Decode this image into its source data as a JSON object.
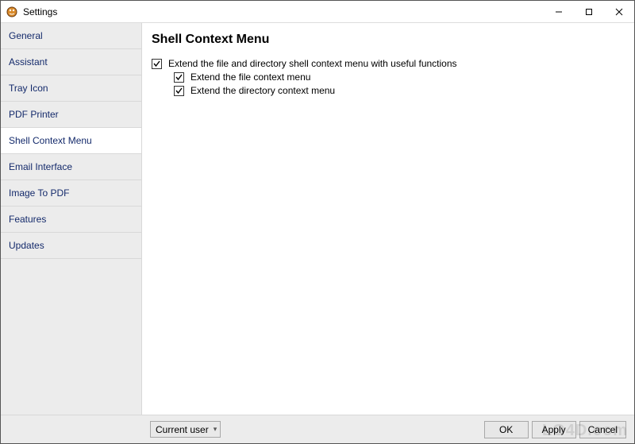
{
  "window": {
    "title": "Settings"
  },
  "sidebar": {
    "items": [
      {
        "label": "General"
      },
      {
        "label": "Assistant"
      },
      {
        "label": "Tray Icon"
      },
      {
        "label": "PDF Printer"
      },
      {
        "label": "Shell Context Menu",
        "active": true
      },
      {
        "label": "Email Interface"
      },
      {
        "label": "Image To PDF"
      },
      {
        "label": "Features"
      },
      {
        "label": "Updates"
      }
    ]
  },
  "page": {
    "heading": "Shell Context Menu",
    "opt_parent": "Extend the file and directory shell context menu with useful functions",
    "opt_file": "Extend the file context menu",
    "opt_dir": "Extend the directory context menu"
  },
  "footer": {
    "scope_value": "Current user",
    "ok": "OK",
    "apply": "Apply",
    "cancel": "Cancel"
  },
  "watermark": "LO4D.com"
}
